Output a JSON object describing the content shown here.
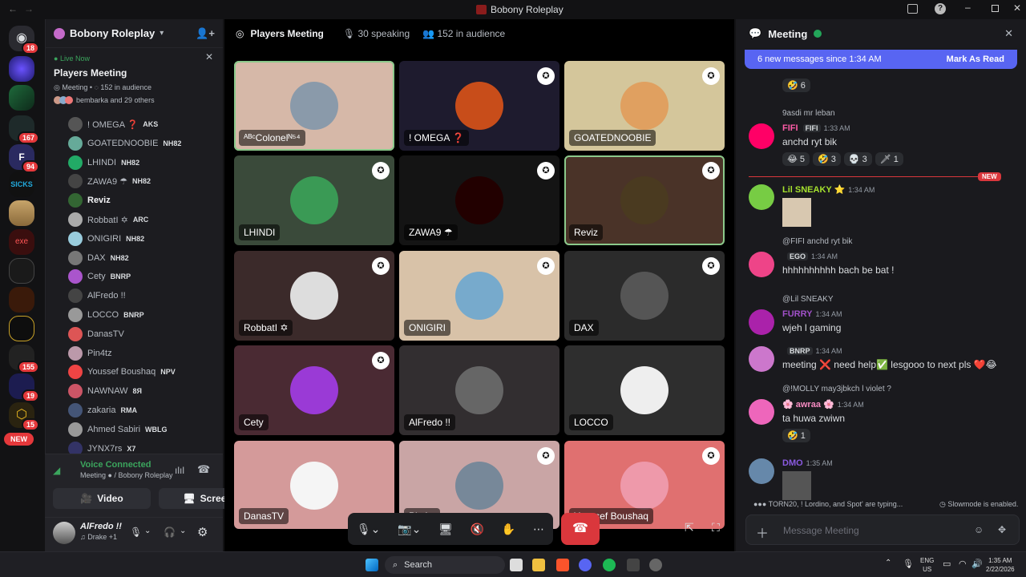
{
  "window": {
    "title": "Bobony Roleplay"
  },
  "servers": [
    {
      "badge": "18"
    },
    {
      "badge": ""
    },
    {
      "badge": ""
    },
    {
      "badge": "167"
    },
    {
      "badge": "94"
    },
    {
      "badge": ""
    },
    {
      "badge": ""
    },
    {
      "badge": ""
    },
    {
      "badge": ""
    },
    {
      "badge": ""
    },
    {
      "badge": "155"
    },
    {
      "badge": "19"
    },
    {
      "badge": "15"
    }
  ],
  "servers_new": "NEW",
  "guild": {
    "name": "Bobony Roleplay"
  },
  "live": {
    "status": "Live Now",
    "title": "Players Meeting",
    "meta_room": "Meeting",
    "meta_audience": "152 in audience",
    "listeners": "bembarka and 29 others"
  },
  "members": [
    {
      "name": "! OMEGA ❓",
      "tag": "AKS"
    },
    {
      "name": "GOATEDNOOBIE",
      "tag": "NH82"
    },
    {
      "name": "LHINDI",
      "tag": "NH82"
    },
    {
      "name": "ZAWA9 ☂",
      "tag": "NH82"
    },
    {
      "name": "Reviz",
      "tag": ""
    },
    {
      "name": "RobbatI ✡",
      "tag": "ARC"
    },
    {
      "name": "ONIGIRI",
      "tag": "NH82"
    },
    {
      "name": "DAX",
      "tag": "NH82"
    },
    {
      "name": "Cety",
      "tag": "BNRP"
    },
    {
      "name": "AlFredo !!",
      "tag": ""
    },
    {
      "name": "LOCCO",
      "tag": "BNRP"
    },
    {
      "name": "DanasTV",
      "tag": ""
    },
    {
      "name": "Pin4tz",
      "tag": ""
    },
    {
      "name": "Youssef Boushaq",
      "tag": "NPV"
    },
    {
      "name": "NAWNAW",
      "tag": "8Я"
    },
    {
      "name": "zakaria",
      "tag": "RMA"
    },
    {
      "name": "Ahmed Sabiri",
      "tag": "WBLG"
    },
    {
      "name": "JYNX7rs",
      "tag": "X7"
    }
  ],
  "voice": {
    "status": "Voice Connected",
    "channel": "Meeting",
    "server": "/ Bobony Roleplay",
    "video_label": "Video",
    "screen_label": "Screen"
  },
  "user": {
    "name": "AlFredo !!",
    "activity": "Drake +1"
  },
  "stage": {
    "title": "Players Meeting",
    "speaking": "30 speaking",
    "audience": "152 in audience",
    "tiles": [
      {
        "name": "ᴬᴮᶜColonelᴺ⁵⁴"
      },
      {
        "name": "! OMEGA ❓"
      },
      {
        "name": "GOATEDNOOBIE"
      },
      {
        "name": "LHINDI"
      },
      {
        "name": "ZAWA9 ☂"
      },
      {
        "name": "Reviz"
      },
      {
        "name": "RobbatI ✡"
      },
      {
        "name": "ONIGIRI"
      },
      {
        "name": "DAX"
      },
      {
        "name": "Cety"
      },
      {
        "name": "AlFredo !!"
      },
      {
        "name": "LOCCO"
      },
      {
        "name": "DanasTV"
      },
      {
        "name": "Pin4tz"
      },
      {
        "name": "Youssef Boushaq"
      }
    ]
  },
  "chat": {
    "title": "Meeting",
    "new_messages": "6 new messages since 1:34 AM",
    "mark_read": "Mark As Read",
    "messages": [
      {
        "reply": "9asdi mr leban",
        "name": "FIFI",
        "tag": "FIFI",
        "time": "1:33 AM",
        "text": "anchd ryt bik",
        "reactions": [
          "😂 5",
          "🤣 3",
          "💀 3",
          "🗡 1"
        ]
      },
      {
        "reply": "",
        "name": "Lil SNEAKY ⭐",
        "tag": "",
        "time": "1:34 AM",
        "text": "",
        "reactions": []
      },
      {
        "reply": "@FIFI  anchd ryt bik",
        "name": "",
        "tag": "EGO",
        "time": "1:34 AM",
        "text": "hhhhhhhhhh bach be bat !",
        "reactions": []
      },
      {
        "reply": "@Lil SNEAKY",
        "name": "FURRY",
        "tag": "",
        "time": "1:34 AM",
        "text": "wjeh l gaming",
        "reactions": []
      },
      {
        "reply": "",
        "name": "",
        "tag": "BNRP",
        "time": "1:34 AM",
        "text": "meeting ❌ need help✅ lesgooo to next pls ❤️😂",
        "reactions": []
      },
      {
        "reply": "@!MOLLY  may3jbkch l violet ?",
        "name": "🌸 awraa 🌸",
        "tag": "",
        "time": "1:34 AM",
        "text": "ta huwa zwiwn",
        "reactions": [
          "🤣 1"
        ]
      },
      {
        "reply": "",
        "name": "DMO",
        "tag": "",
        "time": "1:35 AM",
        "text": "",
        "reactions": []
      }
    ],
    "prev_reaction": "🤣 6",
    "new_divider": "NEW",
    "typing": "TORN20, ! Lordino, and Spot' are typing...",
    "slowmode": "Slowmode is enabled.",
    "input_placeholder": "Message Meeting"
  },
  "taskbar": {
    "search": "Search",
    "lang": "ENG",
    "region": "US",
    "time": "1:35 AM",
    "date": "2/22/2026"
  }
}
